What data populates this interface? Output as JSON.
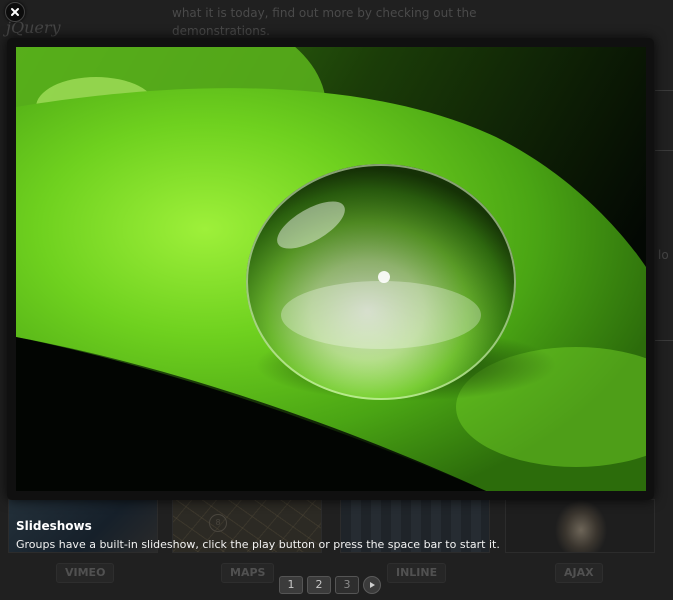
{
  "background": {
    "logo_text": "jQuery",
    "intro_text": "what it is today, find out more by checking out the demonstrations.",
    "side_text": "lo",
    "thumbnails": [
      {
        "label": "VIMEO"
      },
      {
        "label": "MAPS"
      },
      {
        "label": "INLINE"
      },
      {
        "label": "AJAX"
      }
    ],
    "pagination": {
      "pages": [
        "1",
        "2",
        "3"
      ],
      "current_page": "3",
      "next_icon": "play-arrow-icon"
    }
  },
  "lightbox": {
    "close_icon": "close-icon",
    "image_subject": "water droplet on green leaf",
    "caption": {
      "title": "Slideshows",
      "text": "Groups have a built-in slideshow, click the play button or press the space bar to start it."
    }
  },
  "colors": {
    "overlay": "#202020",
    "lightbox_frame": "#101010",
    "caption_text": "#ffffff",
    "leaf_green": "#5ec51a"
  }
}
